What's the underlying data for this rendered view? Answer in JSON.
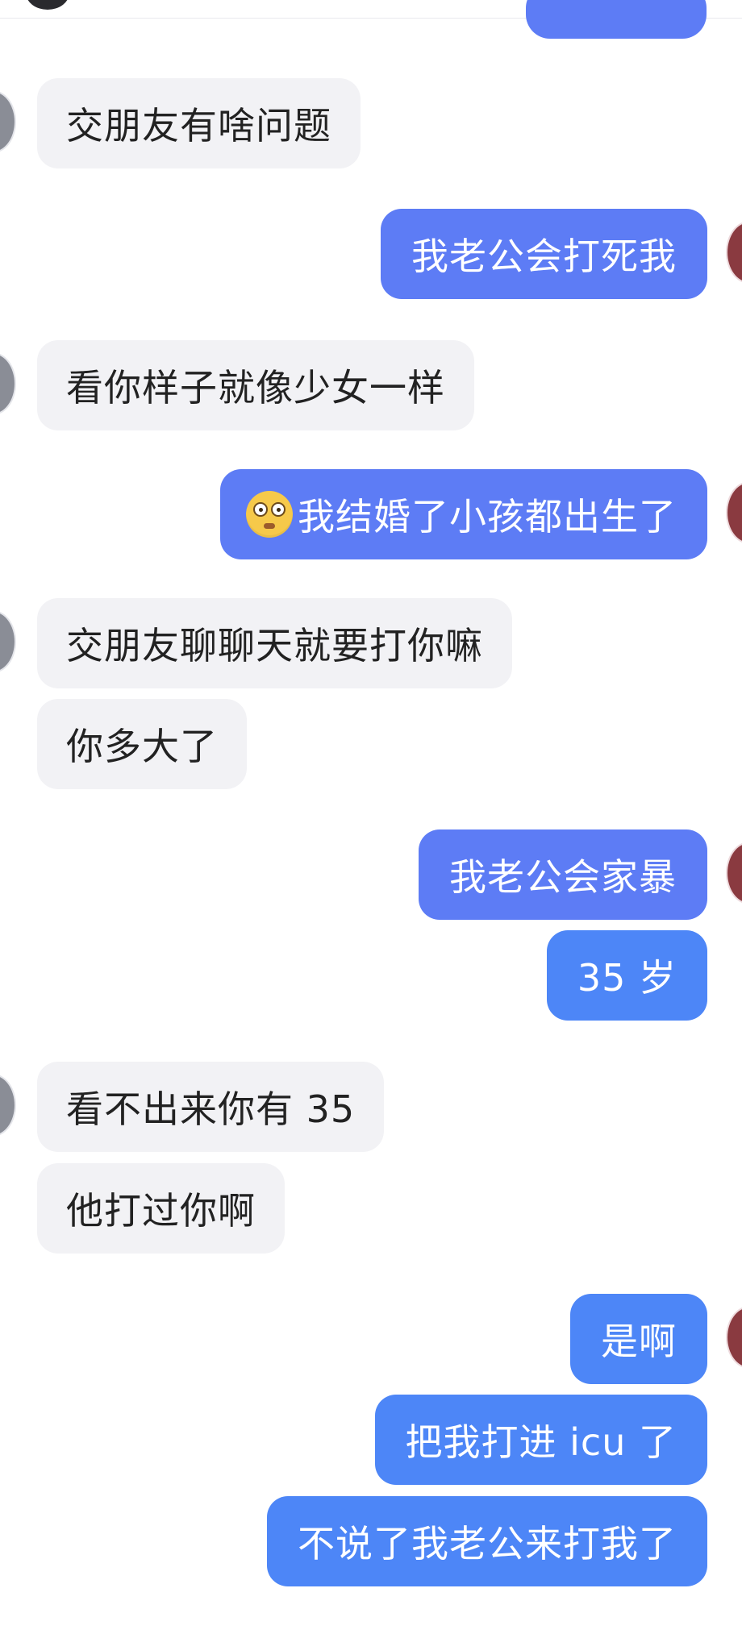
{
  "messages": [
    {
      "side": "in",
      "text": "交朋友有啥问题"
    },
    {
      "side": "out",
      "text": "我老公会打死我"
    },
    {
      "side": "in",
      "text": "看你样子就像少女一样"
    },
    {
      "side": "out",
      "text": "我结婚了小孩都出生了",
      "emoji": "flushed-face-icon"
    },
    {
      "side": "in",
      "text": "交朋友聊聊天就要打你嘛"
    },
    {
      "side": "in",
      "text": "你多大了"
    },
    {
      "side": "out",
      "text": "我老公会家暴"
    },
    {
      "side": "out",
      "text": "35 岁"
    },
    {
      "side": "in",
      "text": "看不出来你有 35"
    },
    {
      "side": "in",
      "text": "他打过你啊"
    },
    {
      "side": "out",
      "text": "是啊"
    },
    {
      "side": "out",
      "text": "把我打进 icu 了"
    },
    {
      "side": "out",
      "text": "不说了我老公来打我了"
    }
  ],
  "colors": {
    "incoming_bubble": "#f2f2f5",
    "outgoing_bubble_violet": "#5d7cf5",
    "outgoing_bubble_blue": "#4d86f7"
  }
}
